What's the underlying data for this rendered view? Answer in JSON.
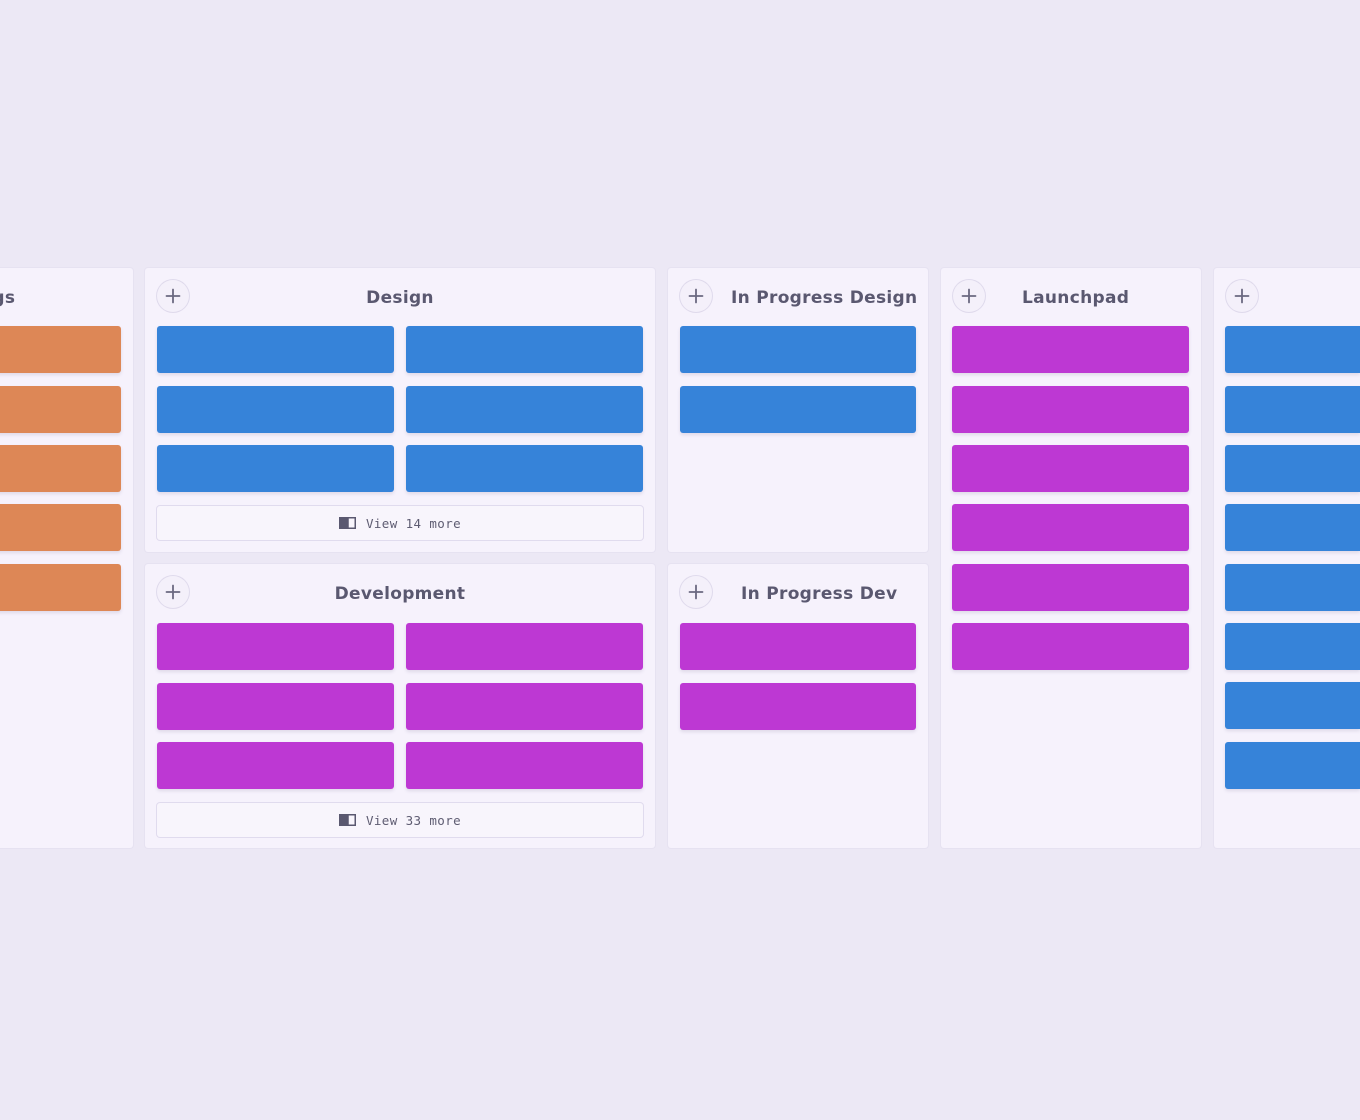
{
  "colors": {
    "background": "#ece8f5",
    "panel": "#f6f2fc",
    "orange_card": "#dd8756",
    "blue_card": "#3683d9",
    "purple_card": "#bd38d3",
    "title_text": "#5a5870"
  },
  "board": {
    "columns": [
      {
        "title": "ngs",
        "card_color": "orange",
        "cards": 5
      },
      {
        "title": "Design",
        "card_color": "blue",
        "cards": 6,
        "add_icon": "plus-icon",
        "view_more": {
          "icon": "card-stack-icon",
          "label": "View 14 more"
        }
      },
      {
        "title": "Development",
        "card_color": "purple",
        "cards": 6,
        "add_icon": "plus-icon",
        "view_more": {
          "icon": "card-stack-icon",
          "label": "View 33 more"
        }
      },
      {
        "title": "In Progress Design",
        "card_color": "blue",
        "cards": 2,
        "add_icon": "plus-icon"
      },
      {
        "title": "In Progress Dev",
        "card_color": "purple",
        "cards": 2,
        "add_icon": "plus-icon"
      },
      {
        "title": "Launchpad",
        "card_color": "purple",
        "cards": 6,
        "add_icon": "plus-icon"
      },
      {
        "title": "",
        "card_color": "blue",
        "cards": 8,
        "add_icon": "plus-icon"
      }
    ]
  }
}
